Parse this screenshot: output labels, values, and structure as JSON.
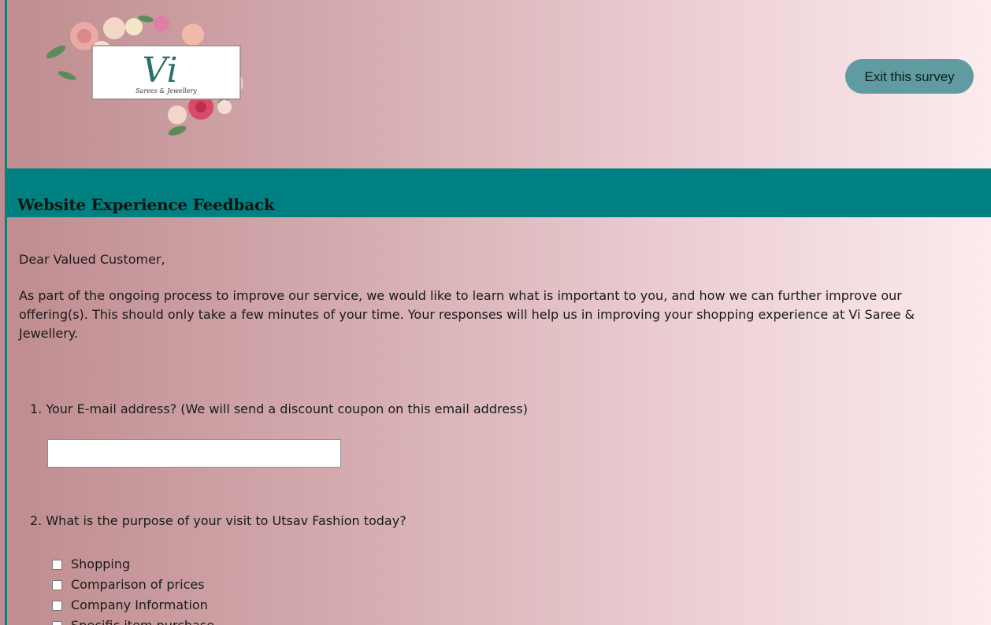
{
  "header": {
    "logo": {
      "monogram": "Vi",
      "tagline": "Sarees & Jewellery"
    },
    "exit_label": "Exit this survey"
  },
  "survey": {
    "title": "Website Experience Feedback",
    "greeting": "Dear Valued Customer,",
    "intro": "As part of the ongoing process to improve our service, we would like to learn what is important to you, and how we can further improve our offering(s). This should only take a few minutes of your time. Your responses will help us in improving your shopping experience at Vi Saree & Jewellery.",
    "questions": [
      {
        "label": "1. Your E-mail address? (We will send a discount coupon on this email address)",
        "input_value": "",
        "input_placeholder": ""
      },
      {
        "label": "2. What is the purpose of your visit to Utsav Fashion today?",
        "options": [
          "Shopping",
          "Comparison of prices",
          "Company Information",
          "Specific item purchase"
        ]
      }
    ]
  },
  "colors": {
    "teal": "#008080",
    "button": "#5f9ba0"
  }
}
